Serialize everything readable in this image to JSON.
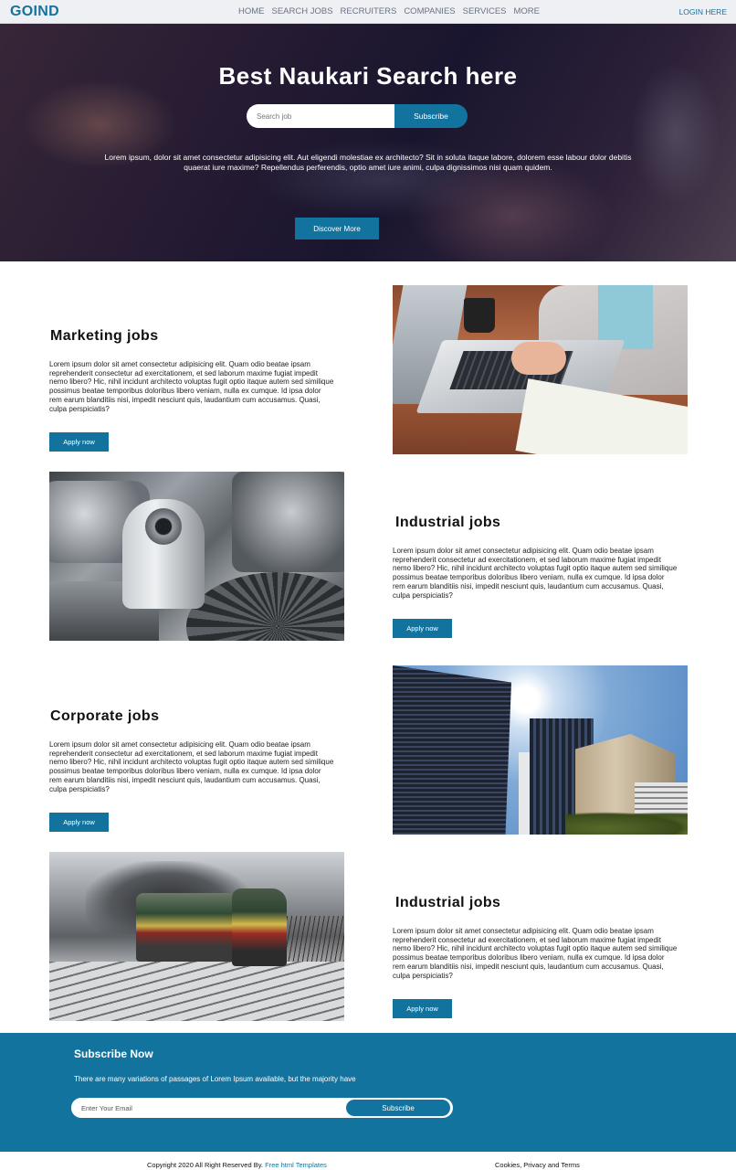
{
  "nav": {
    "logo": "GOIND",
    "items": [
      {
        "label": "HOME"
      },
      {
        "label": "SEARCH JOBS"
      },
      {
        "label": "RECRUITERS"
      },
      {
        "label": "COMPANIES"
      },
      {
        "label": "SERVICES"
      },
      {
        "label": "MORE"
      }
    ],
    "login": "LOGIN HERE"
  },
  "hero": {
    "title": "Best Naukari Search here",
    "search_placeholder": "Search job",
    "search_button": "Subscribe",
    "text": "Lorem ipsum, dolor sit amet consectetur adipisicing elit. Aut eligendi molestiae ex architecto? Sit in soluta itaque labore, dolorem esse labour dolor debitis quaerat iure maxime? Repellendus perferendis, optio amet iure animi, culpa dignissimos nisi quam quidem.",
    "cta": "Discover More"
  },
  "jobs": [
    {
      "title": "Marketing  jobs",
      "text": "Lorem ipsum dolor sit amet consectetur adipisicing elit. Quam odio beatae ipsam reprehenderit consectetur ad exercitationem, et sed laborum maxime fugiat impedit nemo libero? Hic, nihil incidunt architecto voluptas fugit optio itaque autem sed similique possimus beatae temporibus doloribus libero veniam, nulla ex cumque. Id ipsa dolor rem earum blanditiis nisi, impedit nesciunt quis, laudantium cum accusamus. Quasi, culpa perspiciatis?",
      "button": "Apply now"
    },
    {
      "title": "Industrial  jobs",
      "text": "Lorem ipsum dolor sit amet consectetur adipisicing elit. Quam odio beatae ipsam reprehenderit consectetur ad exercitationem, et sed laborum maxime fugiat impedit nemo libero? Hic, nihil incidunt architecto voluptas fugit optio itaque autem sed similique possimus beatae temporibus doloribus libero veniam, nulla ex cumque. Id ipsa dolor rem earum blanditiis nisi, impedit nesciunt quis, laudantium cum accusamus. Quasi, culpa perspiciatis?",
      "button": "Apply now"
    },
    {
      "title": "Corporate  jobs",
      "text": "Lorem ipsum dolor sit amet consectetur adipisicing elit. Quam odio beatae ipsam reprehenderit consectetur ad exercitationem, et sed laborum maxime fugiat impedit nemo libero? Hic, nihil incidunt architecto voluptas fugit optio itaque autem sed similique possimus beatae temporibus doloribus libero veniam, nulla ex cumque. Id ipsa dolor rem earum blanditiis nisi, impedit nesciunt quis, laudantium cum accusamus. Quasi, culpa perspiciatis?",
      "button": "Apply now"
    },
    {
      "title": "Industrial  jobs",
      "text": "Lorem ipsum dolor sit amet consectetur adipisicing elit. Quam odio beatae ipsam reprehenderit consectetur ad exercitationem, et sed laborum maxime fugiat impedit nemo libero? Hic, nihil incidunt architecto voluptas fugit optio itaque autem sed similique possimus beatae temporibus doloribus libero veniam, nulla ex cumque. Id ipsa dolor rem earum blanditiis nisi, impedit nesciunt quis, laudantium cum accusamus. Quasi, culpa perspiciatis?",
      "button": "Apply now"
    }
  ],
  "subscribe": {
    "title": "Subscribe Now",
    "text": "There are many variations of passages of Lorem Ipsum available, but the majority have",
    "placeholder": "Enter Your Email",
    "button": "Subscribe"
  },
  "footer": {
    "copyright_prefix": "Copyright 2020 All Right Reserved By.",
    "copyright_link": "Free html Templates",
    "policy": "Cookies, Privacy and Terms"
  },
  "colors": {
    "brand": "#13739f"
  }
}
